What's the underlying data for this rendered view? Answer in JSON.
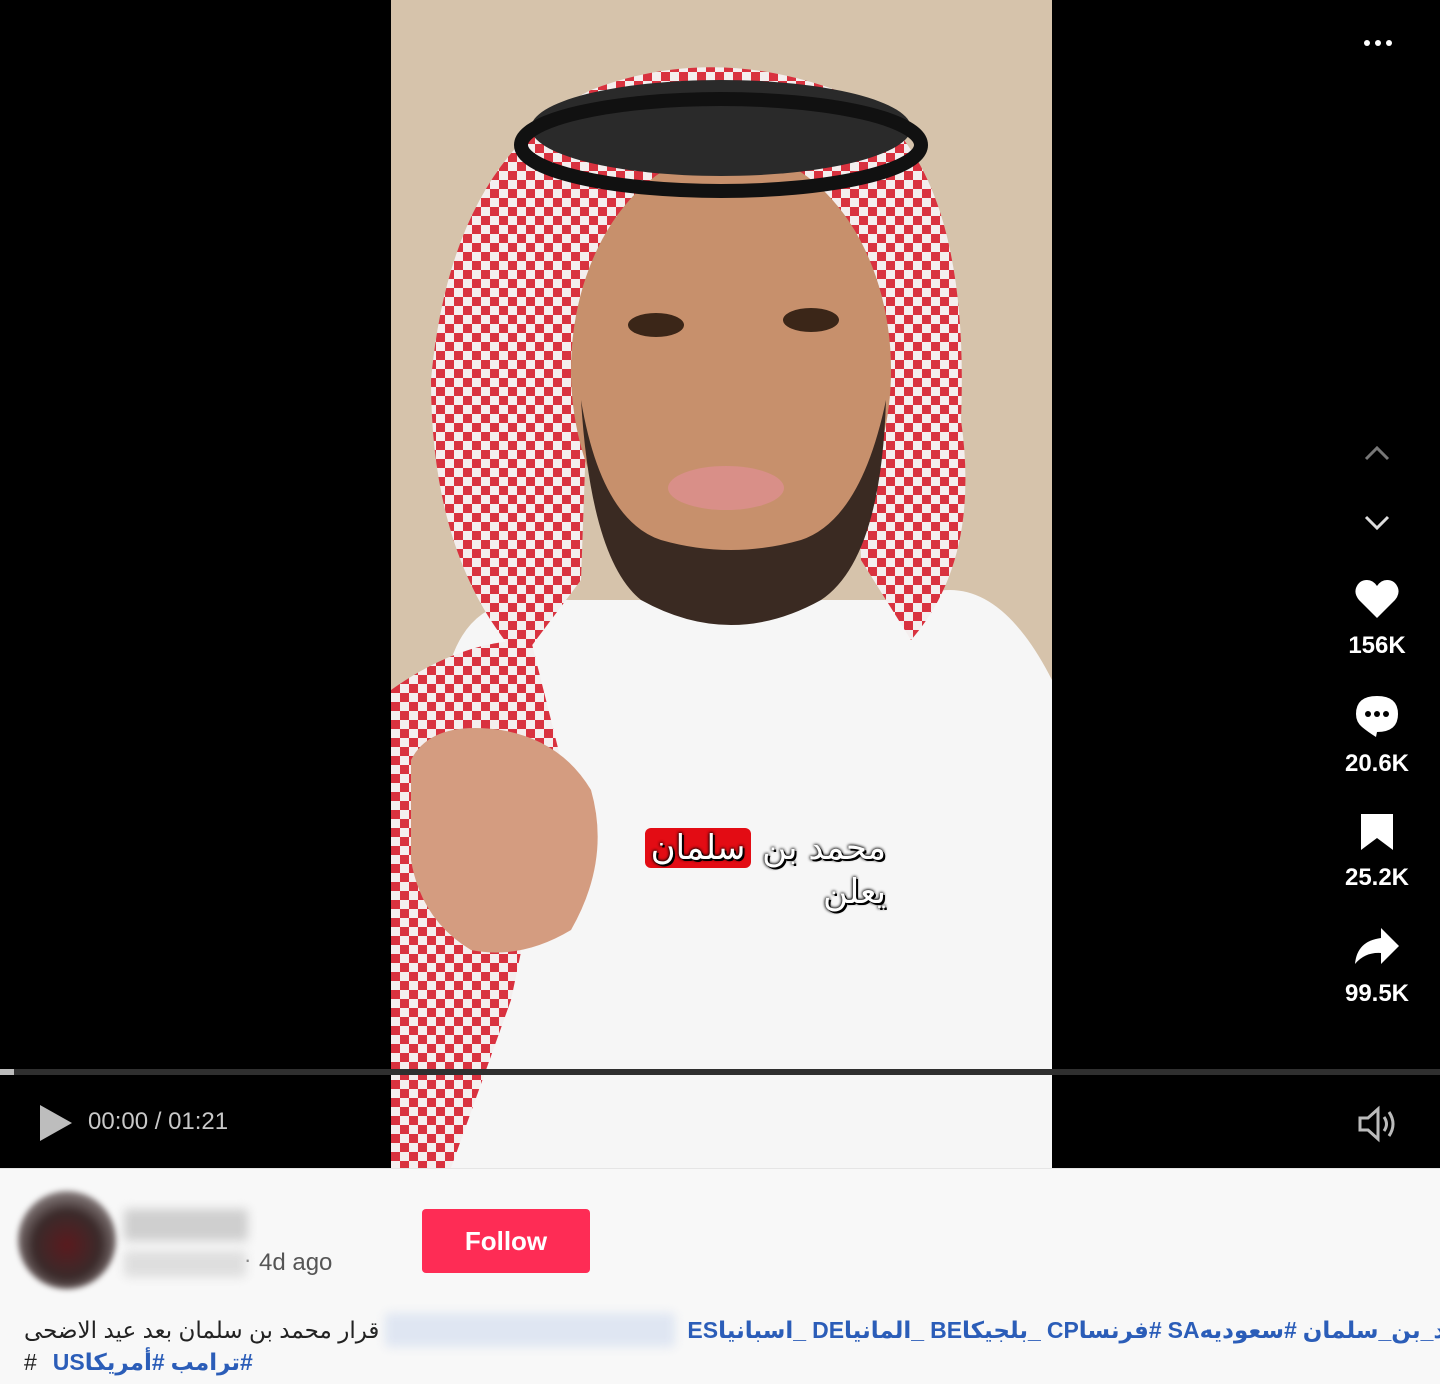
{
  "caption": {
    "line1_highlight": "سلمان",
    "line1_rest": "محمد بن",
    "line2": "يعلن"
  },
  "actions": {
    "likes": "156K",
    "comments": "20.6K",
    "saves": "25.2K",
    "shares": "99.5K"
  },
  "playback": {
    "time": "00:00 / 01:21",
    "progress": 0
  },
  "author": {
    "posted_ago": "4d ago",
    "follow_label": "Follow"
  },
  "description": {
    "text": "قرار محمد بن سلمان بعد عيد الاضحى",
    "tags_line1": [
      "#محمد_بن_سلمان",
      "#سعوديهSA",
      "#فرنساCP",
      "_بلجيكاBE",
      "_المانياDE",
      "_اسبانياES"
    ],
    "hash": "#",
    "tags_line2": [
      "#ترامب",
      "#أمريكاUS"
    ]
  },
  "colors": {
    "follow_bg": "#fe2c55",
    "hashtag": "#2b5db8",
    "caption_highlight": "#e30c14"
  }
}
